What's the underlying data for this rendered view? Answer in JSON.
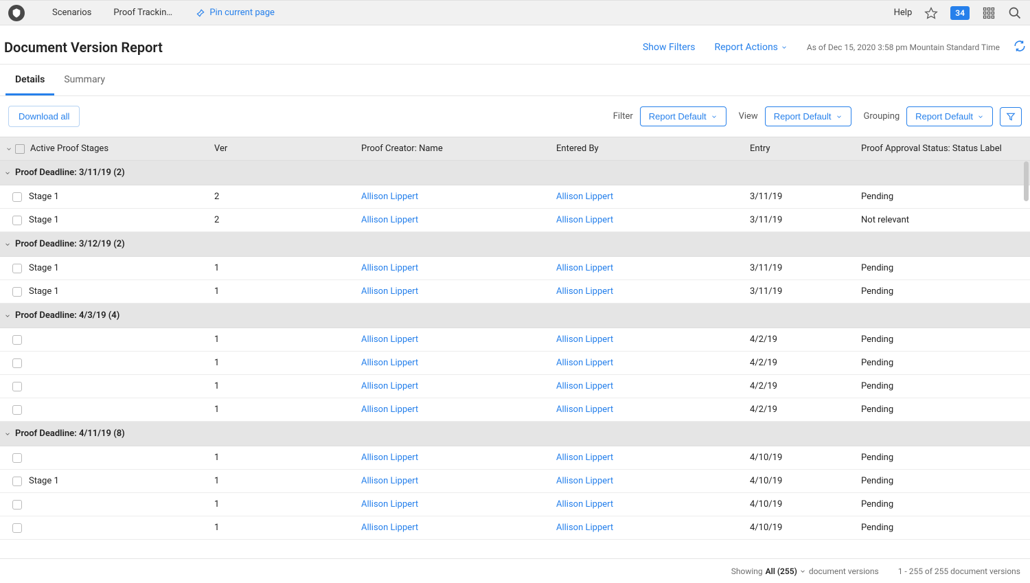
{
  "topbar": {
    "breadcrumbs": [
      "Scenarios",
      "Proof Tracking Das..."
    ],
    "pin_label": "Pin current page",
    "help_label": "Help",
    "badge_count": "34"
  },
  "header": {
    "title": "Document Version Report",
    "show_filters": "Show Filters",
    "report_actions": "Report Actions",
    "as_of": "As of Dec 15, 2020 3:58 pm Mountain Standard Time"
  },
  "tabs": {
    "details": "Details",
    "summary": "Summary"
  },
  "toolbar": {
    "download_all": "Download all",
    "filter_label": "Filter",
    "filter_value": "Report Default",
    "view_label": "View",
    "view_value": "Report Default",
    "grouping_label": "Grouping",
    "grouping_value": "Report Default"
  },
  "columns": {
    "stage": "Active Proof Stages",
    "ver": "Ver",
    "creator": "Proof Creator: Name",
    "entered": "Entered By",
    "entry": "Entry",
    "status": "Proof Approval Status: Status Label"
  },
  "groups": [
    {
      "label": "Proof Deadline: 3/11/19 (2)",
      "rows": [
        {
          "stage": "Stage 1",
          "ver": "2",
          "creator": "Allison Lippert",
          "entered": "Allison Lippert",
          "entry": "3/11/19",
          "status": "Pending"
        },
        {
          "stage": "Stage 1",
          "ver": "2",
          "creator": "Allison Lippert",
          "entered": "Allison Lippert",
          "entry": "3/11/19",
          "status": "Not relevant"
        }
      ]
    },
    {
      "label": "Proof Deadline: 3/12/19 (2)",
      "rows": [
        {
          "stage": "Stage 1",
          "ver": "1",
          "creator": "Allison Lippert",
          "entered": "Allison Lippert",
          "entry": "3/11/19",
          "status": "Pending"
        },
        {
          "stage": "Stage 1",
          "ver": "1",
          "creator": "Allison Lippert",
          "entered": "Allison Lippert",
          "entry": "3/11/19",
          "status": "Pending"
        }
      ]
    },
    {
      "label": "Proof Deadline: 4/3/19 (4)",
      "rows": [
        {
          "stage": "",
          "ver": "1",
          "creator": "Allison Lippert",
          "entered": "Allison Lippert",
          "entry": "4/2/19",
          "status": "Pending"
        },
        {
          "stage": "",
          "ver": "1",
          "creator": "Allison Lippert",
          "entered": "Allison Lippert",
          "entry": "4/2/19",
          "status": "Pending"
        },
        {
          "stage": "",
          "ver": "1",
          "creator": "Allison Lippert",
          "entered": "Allison Lippert",
          "entry": "4/2/19",
          "status": "Pending"
        },
        {
          "stage": "",
          "ver": "1",
          "creator": "Allison Lippert",
          "entered": "Allison Lippert",
          "entry": "4/2/19",
          "status": "Pending"
        }
      ]
    },
    {
      "label": "Proof Deadline: 4/11/19 (8)",
      "rows": [
        {
          "stage": "",
          "ver": "1",
          "creator": "Allison Lippert",
          "entered": "Allison Lippert",
          "entry": "4/10/19",
          "status": "Pending"
        },
        {
          "stage": "Stage 1",
          "ver": "1",
          "creator": "Allison Lippert",
          "entered": "Allison Lippert",
          "entry": "4/10/19",
          "status": "Pending"
        },
        {
          "stage": "",
          "ver": "1",
          "creator": "Allison Lippert",
          "entered": "Allison Lippert",
          "entry": "4/10/19",
          "status": "Pending"
        },
        {
          "stage": "",
          "ver": "1",
          "creator": "Allison Lippert",
          "entered": "Allison Lippert",
          "entry": "4/10/19",
          "status": "Pending"
        }
      ]
    }
  ],
  "footer": {
    "showing": "Showing",
    "all": "All (255)",
    "doc_versions_1": "document versions",
    "range": "1 - 255 of 255",
    "doc_versions_2": "document versions"
  }
}
